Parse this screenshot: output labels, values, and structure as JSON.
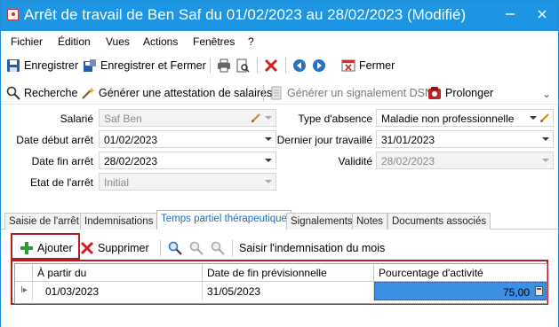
{
  "window": {
    "title": "Arrêt de travail de Ben Saf du 01/02/2023 au 28/02/2023 (Modifié)"
  },
  "menu": [
    "Fichier",
    "Édition",
    "Vues",
    "Actions",
    "Fenêtres",
    "?"
  ],
  "toolbar": {
    "save": "Enregistrer",
    "save_close": "Enregistrer et Fermer",
    "close": "Fermer"
  },
  "toolbar2": {
    "search": "Recherche",
    "salary_cert": "Générer une attestation de salaires",
    "dsn": "Générer un signalement DSN",
    "extend": "Prolonger"
  },
  "form": {
    "salarie_label": "Salarié",
    "salarie_value": "Saf Ben",
    "debut_label": "Date début arrêt",
    "debut_value": "01/02/2023",
    "fin_label": "Date fin arrêt",
    "fin_value": "28/02/2023",
    "etat_label": "Etat de l'arrêt",
    "etat_value": "Initial",
    "type_label": "Type d'absence",
    "type_value": "Maladie non professionnelle",
    "dernier_label": "Dernier jour travaillé",
    "dernier_value": "31/01/2023",
    "validite_label": "Validité",
    "validite_value": "28/02/2023"
  },
  "tabs": [
    "Saisie de l'arrêt",
    "Indemnisations",
    "Temps partiel thérapeutique",
    "Signalements",
    "Notes",
    "Documents associés"
  ],
  "pane": {
    "add": "Ajouter",
    "delete": "Supprimer",
    "saisir": "Saisir l'indemnisation du mois"
  },
  "grid": {
    "columns": [
      "À partir du",
      "Date de fin prévisionnelle",
      "Pourcentage d'activité"
    ],
    "rows": [
      {
        "start": "01/03/2023",
        "end": "31/05/2023",
        "pct": "75,00"
      }
    ]
  },
  "colors": {
    "accent": "#1e95e3",
    "highlight": "#b41e23",
    "selection": "#3b8fe4"
  }
}
